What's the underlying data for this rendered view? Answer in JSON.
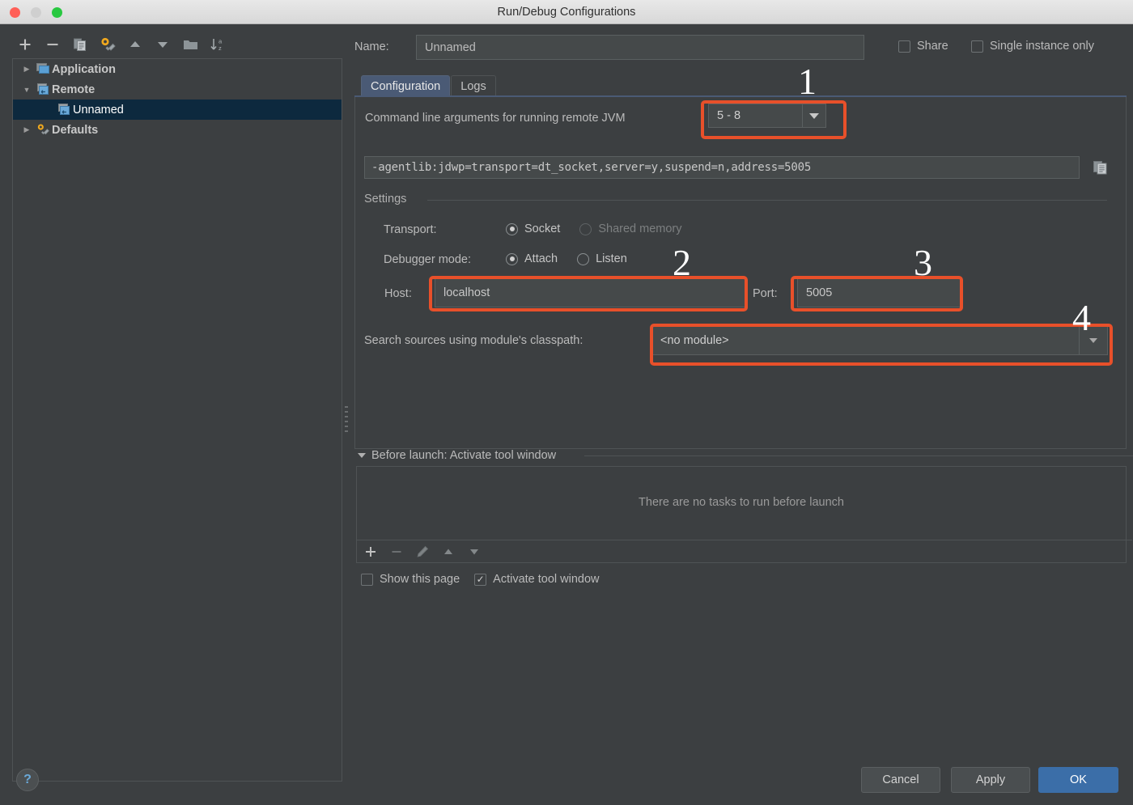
{
  "window": {
    "title": "Run/Debug Configurations",
    "traffic_lights": [
      "close",
      "minimize",
      "zoom"
    ]
  },
  "sidebar": {
    "toolbar": [
      {
        "name": "add-button",
        "icon": "plus-icon",
        "label": "+"
      },
      {
        "name": "remove-button",
        "icon": "minus-icon",
        "label": "−"
      },
      {
        "name": "copy-configuration-button",
        "icon": "copy-icon",
        "label": ""
      },
      {
        "name": "edit-defaults-button",
        "icon": "wrench-gear-icon",
        "label": ""
      },
      {
        "name": "move-up-button",
        "icon": "arrow-up-icon",
        "label": ""
      },
      {
        "name": "move-down-button",
        "icon": "arrow-down-icon",
        "label": ""
      },
      {
        "name": "move-into-folder-button",
        "icon": "folder-icon",
        "label": ""
      },
      {
        "name": "sort-configurations-button",
        "icon": "sort-az-icon",
        "label": ""
      }
    ],
    "tree": [
      {
        "label": "Application",
        "expanded": false,
        "level": 1,
        "icon": "application-icon",
        "selected": false,
        "bold": true
      },
      {
        "label": "Remote",
        "expanded": true,
        "level": 1,
        "icon": "remote-icon",
        "selected": false,
        "bold": true
      },
      {
        "label": "Unnamed",
        "expanded": null,
        "level": 2,
        "icon": "remote-icon",
        "selected": true,
        "bold": false
      },
      {
        "label": "Defaults",
        "expanded": false,
        "level": 1,
        "icon": "wrench-gear-icon",
        "selected": false,
        "bold": true
      }
    ]
  },
  "main": {
    "name_label": "Name:",
    "name_value": "Unnamed",
    "share": {
      "label": "Share",
      "checked": false
    },
    "single_instance": {
      "label": "Single instance only",
      "checked": false
    },
    "tabs": [
      {
        "label": "Configuration",
        "active": true
      },
      {
        "label": "Logs",
        "active": false
      }
    ],
    "command_line_label": "Command line arguments for running remote JVM",
    "jdk_version": "5 - 8",
    "agent_args": "-agentlib:jdwp=transport=dt_socket,server=y,suspend=n,address=5005",
    "settings_legend": "Settings",
    "transport": {
      "label": "Transport:",
      "options": [
        {
          "label": "Socket",
          "selected": true,
          "disabled": false
        },
        {
          "label": "Shared memory",
          "selected": false,
          "disabled": true
        }
      ]
    },
    "debugger_mode": {
      "label": "Debugger mode:",
      "options": [
        {
          "label": "Attach",
          "selected": true,
          "disabled": false
        },
        {
          "label": "Listen",
          "selected": false,
          "disabled": false
        }
      ]
    },
    "host": {
      "label": "Host:",
      "value": "localhost"
    },
    "port": {
      "label": "Port:",
      "value": "5005"
    },
    "module_classpath": {
      "label": "Search sources using module's classpath:",
      "value": "<no module>"
    },
    "before_launch": {
      "header": "Before launch: Activate tool window",
      "empty_text": "There are no tasks to run before launch",
      "toolbar": [
        {
          "name": "add-task-button",
          "icon": "plus-icon"
        },
        {
          "name": "remove-task-button",
          "icon": "minus-icon"
        },
        {
          "name": "edit-task-button",
          "icon": "pencil-icon"
        },
        {
          "name": "move-task-up-button",
          "icon": "arrow-up-icon"
        },
        {
          "name": "move-task-down-button",
          "icon": "arrow-down-icon"
        }
      ],
      "show_this_page": {
        "label": "Show this page",
        "checked": false
      },
      "activate_tool_window": {
        "label": "Activate tool window",
        "checked": true
      }
    }
  },
  "footer": {
    "help_label": "?",
    "cancel_label": "Cancel",
    "apply_label": "Apply",
    "ok_label": "OK"
  },
  "annotations": {
    "color": "#e8502a",
    "markers": [
      {
        "number": "1",
        "target": "jdk-version-combo"
      },
      {
        "number": "2",
        "target": "host-input"
      },
      {
        "number": "3",
        "target": "port-input"
      },
      {
        "number": "4",
        "target": "module-classpath-combo"
      }
    ]
  }
}
